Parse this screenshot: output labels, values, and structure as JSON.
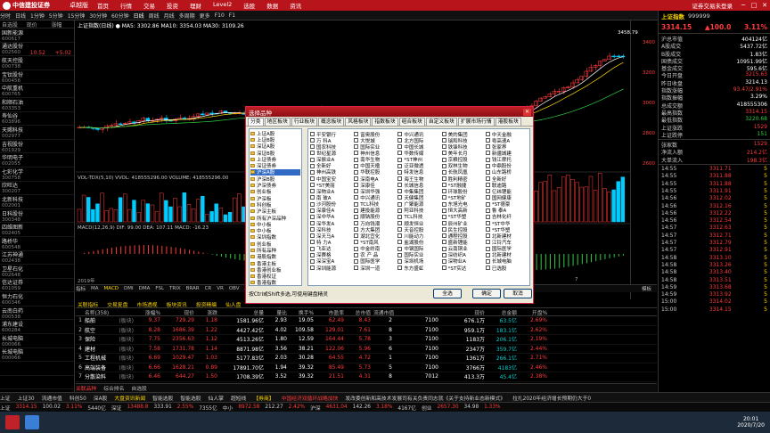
{
  "app": {
    "brand": "中信建投证券",
    "edition": "卓越版",
    "login": "证券交易未登录"
  },
  "menu": [
    "首页",
    "行情",
    "交易",
    "投资",
    "理财",
    "Level2",
    "选股",
    "数据",
    "资讯"
  ],
  "window_controls": [
    "─",
    "□",
    "✕"
  ],
  "toolbar": [
    "分时",
    "日线",
    "1分钟",
    "5分钟",
    "15分钟",
    "30分钟",
    "60分钟",
    "日线",
    "周线",
    "月线",
    "多周期",
    "更多",
    "F10",
    "F1"
  ],
  "watchlist": {
    "headers": [
      "自选股",
      "现价",
      "涨幅"
    ],
    "rows": [
      {
        "name": "国新能源",
        "code": "600617",
        "price": "",
        "change": ""
      },
      {
        "name": "通达股份",
        "code": "002560",
        "price": "10.52",
        "change": "+5.02"
      },
      {
        "name": "航天控股",
        "code": "000738",
        "price": "",
        "change": ""
      },
      {
        "name": "宝钛股份",
        "code": "600456",
        "price": "",
        "change": ""
      },
      {
        "name": "中航重机",
        "code": "600765",
        "price": "",
        "change": ""
      },
      {
        "name": "和顺石油",
        "code": "603353",
        "price": "",
        "change": ""
      },
      {
        "name": "寿仙谷",
        "code": "603896",
        "price": "",
        "change": ""
      },
      {
        "name": "天赐科技",
        "code": "002977",
        "price": "",
        "change": ""
      },
      {
        "name": "吉视股份",
        "code": "601929",
        "price": "",
        "change": ""
      },
      {
        "name": "华明电子",
        "code": "002055",
        "price": "",
        "change": ""
      },
      {
        "name": "七彩化学",
        "code": "300758",
        "price": "",
        "change": ""
      },
      {
        "name": "欣旺达",
        "code": "300207",
        "price": "",
        "change": ""
      },
      {
        "name": "北新科技",
        "code": "002001",
        "price": "",
        "change": ""
      },
      {
        "name": "日科股份",
        "code": "300348",
        "price": "",
        "change": ""
      },
      {
        "name": "四维图新",
        "code": "002405",
        "price": "",
        "change": ""
      },
      {
        "name": "路桥华",
        "code": "600548",
        "price": "",
        "change": ""
      },
      {
        "name": "江苏神通",
        "code": "002438",
        "price": "",
        "change": ""
      },
      {
        "name": "卫星石化",
        "code": "002648",
        "price": "",
        "change": ""
      },
      {
        "name": "信达证券",
        "code": "601059",
        "price": "",
        "change": ""
      },
      {
        "name": "恒力石化",
        "code": "600346",
        "price": "",
        "change": ""
      },
      {
        "name": "云南白药",
        "code": "000538",
        "price": "",
        "change": ""
      },
      {
        "name": "浦东建设",
        "code": "600284",
        "price": "",
        "change": ""
      },
      {
        "name": "长城电脑",
        "code": "000066",
        "price": "",
        "change": ""
      },
      {
        "name": "长城电脑",
        "code": "000066",
        "price": "",
        "change": ""
      },
      {
        "name": "",
        "code": "",
        "price": "",
        "change": ""
      },
      {
        "name": "",
        "code": "",
        "price": "",
        "change": ""
      },
      {
        "name": "",
        "code": "",
        "price": "",
        "change": ""
      }
    ]
  },
  "chart": {
    "head": "上证指数(日线)  ● MA5: 3302.86  MA10: 3354.03  MA30: 3109.26",
    "high_label": "3458.79",
    "axis_labels": [
      "3400",
      "3200",
      "3000",
      "2800",
      "2600"
    ],
    "vol_head": "VOL-TDX(5,10)  VVOL: 418555296.00  VOLUME: 418555296.00",
    "macd_head": "MACD(12,26,9)  DIF: 99.00  DEA: 107.11  MACD: -16.23",
    "date_label": "2019年",
    "date_label2": "7",
    "tabs": [
      "指标",
      "MA",
      "MACD",
      "DMI",
      "DMA",
      "FSL",
      "TRIX",
      "BRAR",
      "CR",
      "VR",
      "OBV",
      "ASI"
    ],
    "tab_right": "模板"
  },
  "chart_data": {
    "type": "line",
    "series": [
      {
        "name": "MA5",
        "color": "#ffffff"
      },
      {
        "name": "MA10",
        "color": "#ffd700"
      },
      {
        "name": "MA30",
        "color": "#2ecc40"
      }
    ]
  },
  "dialog": {
    "title": "选择品种",
    "close": "✕",
    "tabs": [
      "分类",
      "地区板块",
      "行业板块",
      "概念板块",
      "风格板块",
      "指数板块",
      "组合板块",
      "自定义板块",
      "扩展市场行情",
      "港股板块"
    ],
    "tree": [
      "上证A股",
      "上证B股",
      "深证A股",
      "深证B股",
      "上证债券",
      "深证债券",
      "沪深A股",
      "沪深B股",
      "沪深债券",
      "创业板",
      "沪深板",
      "科创板",
      "沪深主板",
      "所有沪深品种",
      "中小板",
      "中小板",
      "深圳指数",
      "创业板",
      "所有品种",
      "港股指数",
      "香港主板",
      "香港创业板",
      "香港权证",
      "香港指数",
      "港股通",
      "香港信托基金"
    ],
    "tree_selected": 6,
    "columns": [
      [
        "平安银行",
        "万 科A",
        "国农科技",
        "世纪星源",
        "深振业A",
        "全新好",
        "神州高铁",
        "中国宝安",
        "*ST美丽",
        "深物业A",
        "南 玻A",
        "沙河股份",
        "深康佳A",
        "深中华A",
        "深华发A",
        "深科技",
        "深天马A",
        "特 力A",
        "飞亚达",
        "深赛格",
        "深深宝A",
        "深圳能源"
      ],
      [
        "富奥股份",
        "大悦城",
        "国际实业",
        "神州信息",
        "南华生物",
        "中国天楹",
        "华联控股",
        "深南电A",
        "深康佳",
        "深圳华强",
        "中兴通讯",
        "TCL科技",
        "建投能源",
        "顺钠股份",
        "万向钱潮",
        "方大集团",
        "湖北宜化",
        "*ST南风",
        "中金岭南",
        "农 产 品",
        "国际医学",
        "深圳一道"
      ],
      [
        "中兴通讯",
        "北方国际",
        "中国长城",
        "华数传媒",
        "*ST神州",
        "泛亚微透",
        "特发信息",
        "海王生物",
        "长城信息",
        "中集集团",
        "天健集团",
        "广聚能源",
        "阿亚科技",
        "TCL科技",
        "顺发恒业",
        "天音控股",
        "川能动力",
        "盐湖股份",
        "中钢国际",
        "国际实业",
        "深圳机场",
        "东方盛虹"
      ],
      [
        "美的集团",
        "瑞和科技",
        "铁锋科技",
        "美年长月",
        "京粮控股",
        "双林生物",
        "长航凤凰",
        "胜利精密",
        "*ST融捷",
        "环球股份",
        "*ST地矿",
        "东旭光电",
        "恒大高新",
        "*ST华塑",
        "辰州矿业",
        "民生控股",
        "通程控股",
        "盛新锂能",
        "云南铜业",
        "深纺织A",
        "深物业A",
        "*ST实达"
      ],
      [
        "中天金融",
        "粤高速A",
        "张家界",
        "新疆城建",
        "钱江摩托",
        "中鼎股份",
        "山东路桥",
        "全新好",
        "联迪路",
        "亿纬锂能",
        "国网健康",
        "*ST德豪",
        "鲁 泰A",
        "吉林化纤",
        "*ST中华",
        "*ST华塑",
        "北新建材",
        "江铃汽车",
        "国际医学",
        "北新建材",
        "长城电脑",
        "已选股"
      ]
    ],
    "tip": "按Ctrl或Shift多选,可使用键盘精灵",
    "buttons": {
      "all": "全选",
      "ok": "确定",
      "cancel": "取消"
    }
  },
  "table": {
    "tabs": [
      "关联指标",
      "交易复盘",
      "市场透视",
      "板块资讯",
      "投资精编",
      "仙人盘"
    ],
    "headers": [
      "",
      "名称(358)",
      "",
      "涨幅%",
      "现价",
      "涨跌",
      "总量",
      "量比",
      "换手%",
      "市盈率",
      "总市值",
      "流通市值",
      "",
      "",
      "",
      "",
      "",
      "",
      "",
      "",
      "",
      "现价",
      "总金额",
      "开盘%"
    ],
    "rows": [
      {
        "no": "1",
        "name": "船舶",
        "tag": "(板块)",
        "chg": "9.37",
        "price": "729.29",
        "diff": "1.18",
        "vol": "1581.96亿",
        "vr": "2.93",
        "turn": "19.05",
        "pe": "62.49",
        "cap": "8.43",
        "cap2": "2",
        "vol2": "7100",
        "amount": "676.1万",
        "r1": "63.5亿",
        "r2": "2.69%"
      },
      {
        "no": "2",
        "name": "航空",
        "tag": "(板块)",
        "chg": "8.28",
        "price": "1686.39",
        "diff": "1.22",
        "vol": "4427.42亿",
        "vr": "4.02",
        "turn": "109.58",
        "pe": "129.01",
        "cap": "7.61",
        "cap2": "8",
        "vol2": "7100",
        "amount": "959.1万",
        "r1": "183.1亿",
        "r2": "2.62%"
      },
      {
        "no": "3",
        "name": "保险",
        "tag": "(板块)",
        "chg": "7.75",
        "price": "2356.63",
        "diff": "1.12",
        "vol": "4513.26亿",
        "vr": "1.80",
        "turn": "12.59",
        "pe": "164.44",
        "cap": "5.78",
        "cap2": "3",
        "vol2": "7100",
        "amount": "1183万",
        "r1": "206.1亿",
        "r2": "2.19%"
      },
      {
        "no": "4",
        "name": "建材",
        "tag": "(板块)",
        "chg": "7.58",
        "price": "1731.78",
        "diff": "1.14",
        "vol": "8871.98亿",
        "vr": "3.56",
        "turn": "38.21",
        "pe": "122.06",
        "cap": "5.96",
        "cap2": "6",
        "vol2": "7100",
        "amount": "2347万",
        "r1": "359.7亿",
        "r2": "2.44%"
      },
      {
        "no": "5",
        "name": "工程机械",
        "tag": "(板块)",
        "chg": "6.69",
        "price": "1029.47",
        "diff": "1.03",
        "vol": "5177.83亿",
        "vr": "2.03",
        "turn": "30.28",
        "pe": "64.55",
        "cap": "4.72",
        "cap2": "1",
        "vol2": "7100",
        "amount": "1361万",
        "r1": "266.1亿",
        "r2": "2.71%"
      },
      {
        "no": "6",
        "name": "高端装备",
        "tag": "(板块)",
        "chg": "6.66",
        "price": "1628.21",
        "diff": "0.89",
        "vol": "17891.70亿",
        "vr": "1.94",
        "turn": "39.32",
        "pe": "85.49",
        "cap": "5.73",
        "cap2": "5",
        "vol2": "7100",
        "amount": "3766万",
        "r1": "4183亿",
        "r2": "2.46%"
      },
      {
        "no": "7",
        "name": "分散染料",
        "tag": "(板块)",
        "chg": "6.46",
        "price": "644.27",
        "diff": "1.50",
        "vol": "1708.39亿",
        "vr": "3.52",
        "turn": "39.32",
        "pe": "21.51",
        "cap": "4.31",
        "cap2": "8",
        "vol2": "7012",
        "amount": "413.3万",
        "r1": "45.4亿",
        "r2": "2.38%"
      }
    ]
  },
  "bottom_tabs": [
    "关联品种",
    "综合排名",
    "自选股"
  ],
  "ticker_left": [
    "上证",
    "上证30",
    "流通市值",
    "科创50",
    "深A股"
  ],
  "ticker": [
    {
      "label": "大盘资讯新闻",
      "color": "#ffd700"
    },
    {
      "label": "智能选股",
      "color": "#ccc"
    },
    {
      "label": "智能选股",
      "color": "#ccc"
    },
    {
      "label": "仙人掌",
      "color": "#ccc"
    },
    {
      "label": "超短线",
      "color": "#ccc"
    },
    {
      "label": "【券商】",
      "color": "#ffd700"
    },
    {
      "label": "中国经济双循环战略加快",
      "color": "#ff3b3b"
    },
    {
      "label": "发改委创新和高技术发展司有关负责同志就《关于支持新业态新模式》",
      "color": "#ccc"
    },
    {
      "label": "拉扎2020年经济增长预期仍大于0",
      "color": "#ccc"
    }
  ],
  "status": [
    {
      "label": "上证",
      "v": "3314.15",
      "c": "#ff3b3b"
    },
    {
      "label": "100.02",
      "v": "3.11%",
      "c": "#ff3b3b"
    },
    {
      "label": "5440亿",
      "v": "",
      "c": "#ccc"
    },
    {
      "label": "深证",
      "v": "13488.8",
      "c": "#ff3b3b"
    },
    {
      "label": "333.91",
      "v": "2.55%",
      "c": "#ff3b3b"
    },
    {
      "label": "7355亿",
      "v": "",
      "c": "#ccc"
    },
    {
      "label": "中小",
      "v": "8972.58",
      "c": "#ff3b3b"
    },
    {
      "label": "212.27",
      "v": "2.42%",
      "c": "#ff3b3b"
    },
    {
      "label": "沪深",
      "v": "4631.04",
      "c": "#ff3b3b"
    },
    {
      "label": "142.26",
      "v": "3.18%",
      "c": "#ff3b3b"
    },
    {
      "label": "4167亿",
      "v": "",
      "c": "#ccc"
    },
    {
      "label": "创业",
      "v": "2657.30",
      "c": "#ff3b3b"
    },
    {
      "label": "34.98",
      "v": "1.33%",
      "c": "#ff3b3b"
    }
  ],
  "right_panel": {
    "title": "上证指数",
    "code": "999999",
    "price": "3314.15",
    "change": "▲100.0",
    "pct": "3.11%",
    "rows": [
      {
        "k": "沪总市值",
        "v": "404124亿",
        "c": "#fff"
      },
      {
        "k": "A股成交",
        "v": "5437.72亿",
        "c": "#fff"
      },
      {
        "k": "B股成交",
        "v": "1.83亿",
        "c": "#fff"
      },
      {
        "k": "国债成交",
        "v": "10951.99亿",
        "c": "#fff"
      },
      {
        "k": "基金成交",
        "v": "595.6亿",
        "c": "#fff"
      },
      {
        "k": "今日开盘",
        "v": "3215.63",
        "c": "#ff3b3b"
      },
      {
        "k": "昨日收盘",
        "v": "3214.13",
        "c": "#fff"
      },
      {
        "k": "指数涨幅",
        "v": "93.47/2.91%",
        "c": "#ff3b3b"
      },
      {
        "k": "指数振幅",
        "v": "3.29%",
        "c": "#fff"
      },
      {
        "k": "总成交额",
        "v": "418555306",
        "c": "#fff"
      },
      {
        "k": "最高指数",
        "v": "3314.15",
        "c": "#ff3b3b"
      },
      {
        "k": "最低指数",
        "v": "3220.68",
        "c": "#2ecc40"
      },
      {
        "k": "上证涨跌",
        "v": "1529",
        "c": "#ff3b3b"
      },
      {
        "k": "上证跌停",
        "v": "151",
        "c": "#2ecc40"
      }
    ],
    "flow": [
      {
        "k": "张家数",
        "v": "1529",
        "c": "#ff3b3b"
      },
      {
        "k": "净流入额",
        "v": "214.2亿",
        "c": "#ff3b3b"
      },
      {
        "k": "大单流入",
        "v": "198.3亿",
        "c": "#ff3b3b"
      }
    ],
    "ticks": [
      {
        "t": "14:55",
        "p": "3311.71",
        "v": "5"
      },
      {
        "t": "14:55",
        "p": "3311.88",
        "v": "5"
      },
      {
        "t": "14:55",
        "p": "3311.88",
        "v": "5"
      },
      {
        "t": "14:55",
        "p": "3311.91",
        "v": "5"
      },
      {
        "t": "14:56",
        "p": "3312.02",
        "v": "5"
      },
      {
        "t": "14:56",
        "p": "3312.16",
        "v": "5"
      },
      {
        "t": "14:56",
        "p": "3312.22",
        "v": "5"
      },
      {
        "t": "14:56",
        "p": "3312.54",
        "v": "5"
      },
      {
        "t": "14:57",
        "p": "3312.63",
        "v": "5"
      },
      {
        "t": "14:57",
        "p": "3312.71",
        "v": "5"
      },
      {
        "t": "14:57",
        "p": "3312.79",
        "v": "5"
      },
      {
        "t": "14:57",
        "p": "3312.91",
        "v": "5"
      },
      {
        "t": "14:58",
        "p": "3313.10",
        "v": "5"
      },
      {
        "t": "14:58",
        "p": "3313.26",
        "v": "5"
      },
      {
        "t": "14:58",
        "p": "3313.40",
        "v": "5"
      },
      {
        "t": "14:58",
        "p": "3313.51",
        "v": "5"
      },
      {
        "t": "14:59",
        "p": "3313.68",
        "v": "5"
      },
      {
        "t": "14:59",
        "p": "3313.92",
        "v": "5"
      },
      {
        "t": "15:00",
        "p": "3314.02",
        "v": "5"
      },
      {
        "t": "15:00",
        "p": "3314.15",
        "v": "5"
      }
    ]
  },
  "clock": {
    "time": "20:01",
    "date": "2020/7/20"
  }
}
